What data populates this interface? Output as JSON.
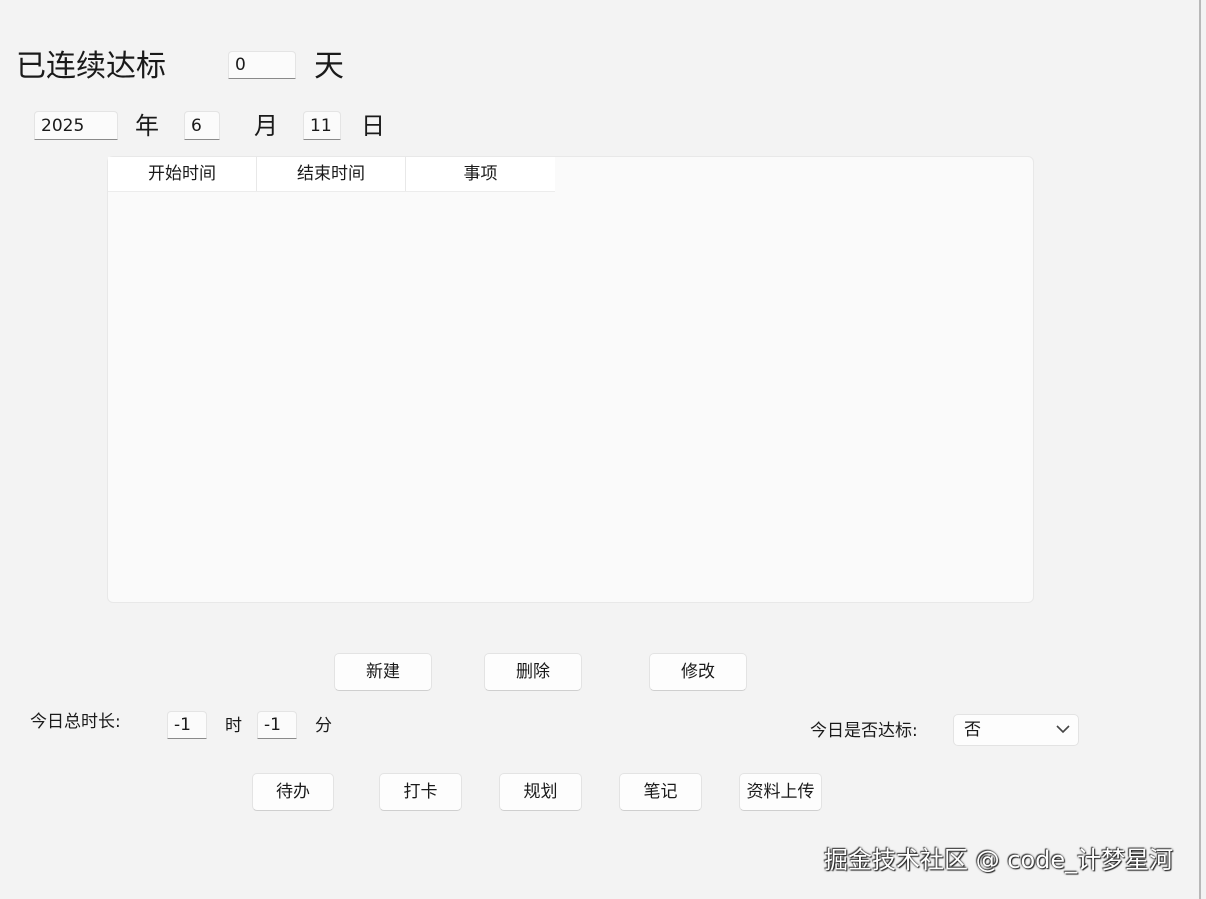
{
  "streak": {
    "label": "已连续达标",
    "value": "0",
    "unit": "天"
  },
  "date": {
    "year_value": "2025",
    "year_label": "年",
    "month_value": "6",
    "month_label": "月",
    "day_value": "11",
    "day_label": "日"
  },
  "table": {
    "columns": [
      "开始时间",
      "结束时间",
      "事项"
    ],
    "rows": []
  },
  "actions": {
    "new_label": "新建",
    "delete_label": "删除",
    "edit_label": "修改"
  },
  "duration": {
    "label": "今日总时长:",
    "hours_value": "-1",
    "hours_label": "时",
    "minutes_value": "-1",
    "minutes_label": "分"
  },
  "goal": {
    "label": "今日是否达标:",
    "selected": "否"
  },
  "nav": {
    "todo_label": "待办",
    "checkin_label": "打卡",
    "plan_label": "规划",
    "notes_label": "笔记",
    "upload_label": "资料上传"
  },
  "watermark": "掘金技术社区 @ code_计梦星河",
  "colors": {
    "background": "#f3f3f3",
    "panel": "#fafafa",
    "text": "#1a1a1a"
  }
}
